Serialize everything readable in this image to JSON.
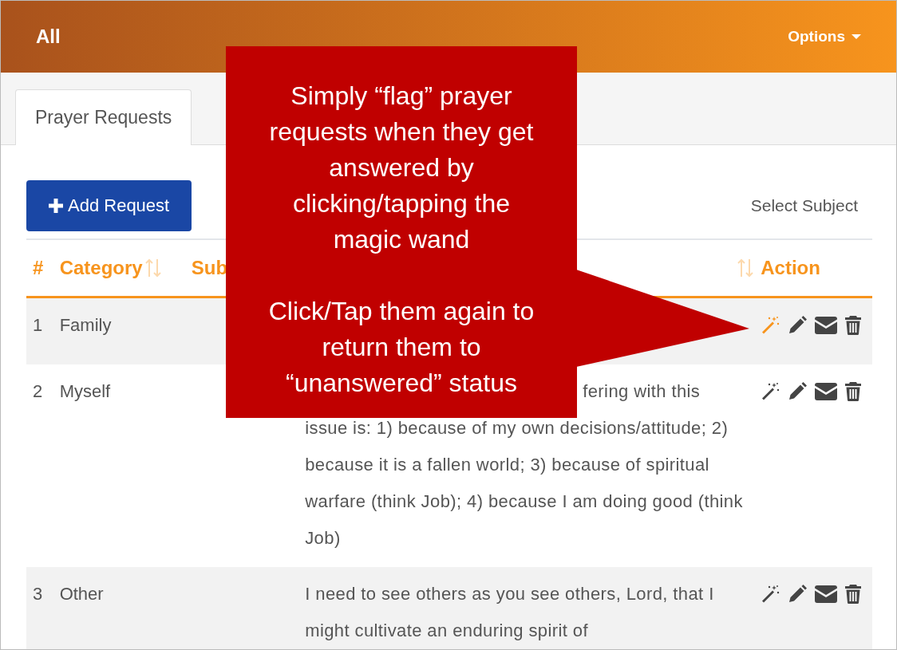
{
  "header": {
    "title": "All",
    "options": "Options"
  },
  "tabs": [
    {
      "label": "Prayer Requests",
      "selected": true
    }
  ],
  "toolbar": {
    "add_button": "Add Request",
    "subject_select": "Select Subject"
  },
  "table": {
    "columns": [
      {
        "label": "#",
        "sortable": false
      },
      {
        "label": "Category",
        "sortable": true
      },
      {
        "label": "Sub",
        "sortable": false
      },
      {
        "sortable": true
      },
      {
        "label": "Action",
        "sortable": false
      }
    ],
    "rows": [
      {
        "number": "1",
        "category": "Family",
        "answered": true
      },
      {
        "number": "2",
        "category": "Myself",
        "description_tail": "fering with this",
        "description": "issue is: 1) because of my own decisions/attitude; 2) because it is a fallen world; 3) because of spiritual warfare (think Job); 4) because I am doing good (think Job)",
        "answered": false
      },
      {
        "number": "3",
        "category": "Other",
        "description": "I need to see others as you see others, Lord, that I might cultivate an enduring spirit of",
        "answered": false
      }
    ]
  },
  "callout": {
    "paragraphs": [
      "Simply “flag” prayer requests when they get answered by clicking/tapping the magic wand",
      "Click/Tap them again to return them to “unanswered” status"
    ]
  }
}
